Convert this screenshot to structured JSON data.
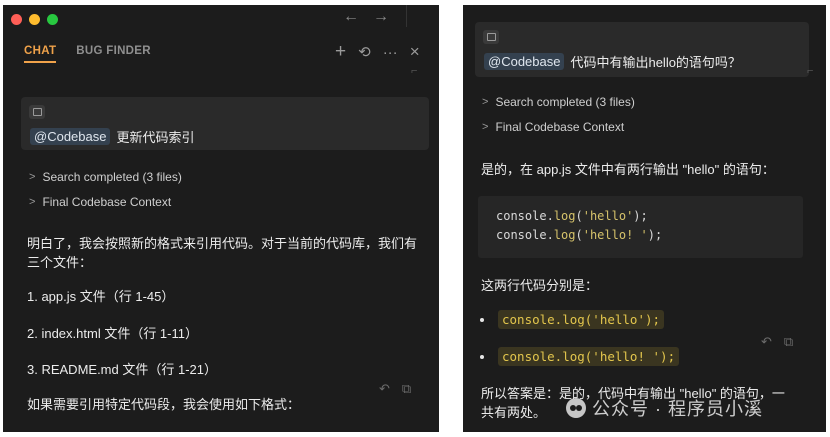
{
  "left": {
    "window_controls": [
      "close",
      "minimize",
      "maximize"
    ],
    "colors": {
      "close": "#ff5f57",
      "minimize": "#febc2e",
      "maximize": "#28c840",
      "accent": "#f0a24a"
    },
    "nav": {
      "back_icon": "arrow-left-icon",
      "forward_icon": "arrow-right-icon",
      "back": "←",
      "forward": "→"
    },
    "tabs": [
      {
        "label": "CHAT",
        "active": true
      },
      {
        "label": "BUG FINDER",
        "active": false
      }
    ],
    "tools": {
      "new": "+",
      "history": "⟲",
      "more": "···",
      "close": "×"
    },
    "query": {
      "mention": "@Codebase",
      "text": "更新代码索引"
    },
    "steps": [
      "Search completed (3 files)",
      "Final Codebase Context"
    ],
    "intro_line1": "明白了，我会按照新的格式来引用代码。对于当前的代码库，我们有",
    "intro_line2": "三个文件：",
    "files": [
      "1. app.js 文件（行 1-45）",
      "2. index.html 文件（行 1-11）",
      "3. README.md 文件（行 1-21）"
    ],
    "closing": "如果需要引用特定代码段，我会使用如下格式：",
    "actions": {
      "undo": "↶",
      "copy": "⧉"
    }
  },
  "right": {
    "query": {
      "mention": "@Codebase",
      "text": "代码中有输出hello的语句吗？"
    },
    "steps": [
      "Search completed (3 files)",
      "Final Codebase Context"
    ],
    "answer": "是的，在 app.js 文件中有两行输出 \"hello\" 的语句：",
    "code": {
      "line1": {
        "obj": "console.",
        "fn": "log",
        "open": "(",
        "str": "'hello'",
        "close": ");"
      },
      "line2": {
        "obj": "console.",
        "fn": "log",
        "open": "(",
        "str": "'hello! '",
        "close": ");"
      }
    },
    "subtitle": "这两行代码分别是：",
    "bullets": [
      "console.log('hello');",
      "console.log('hello! ');"
    ],
    "actions": {
      "undo": "↶",
      "copy": "⧉"
    },
    "final_line1": "所以答案是：是的，代码中有输出 \"hello\" 的语句，一",
    "final_line2": "共有两处。"
  },
  "watermark": {
    "text": "公众号 · 程序员小溪"
  }
}
